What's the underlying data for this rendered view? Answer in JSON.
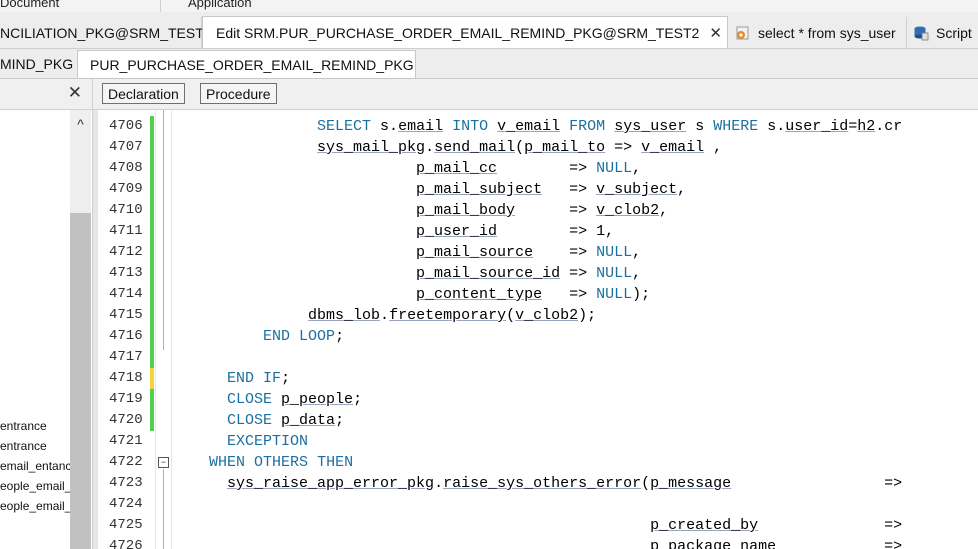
{
  "menu": {
    "items": [
      "Document",
      "Application"
    ]
  },
  "tabs": [
    {
      "label": "NCILIATION_PKG@SRM_TEST2",
      "icon": "none",
      "active": false
    },
    {
      "label": "Edit SRM.PUR_PURCHASE_ORDER_EMAIL_REMIND_PKG@SRM_TEST2",
      "icon": "database-package-icon",
      "active": true,
      "close": "✕"
    },
    {
      "label": "select * from sys_user",
      "icon": "sql-script-icon",
      "active": false
    },
    {
      "label": "Script",
      "icon": "database-script-icon",
      "active": false
    }
  ],
  "subtabs": [
    {
      "label": "MIND_PKG",
      "active": false
    },
    {
      "label": "PUR_PURCHASE_ORDER_EMAIL_REMIND_PKG",
      "active": true
    }
  ],
  "left_panel": {
    "close": "✕",
    "scroll_up": "^",
    "items": [
      "entrance",
      "entrance",
      "email_entanc",
      "eople_email_",
      "eople_email_"
    ]
  },
  "toolbar": {
    "declaration": "Declaration",
    "procedure": "Procedure"
  },
  "colors": {
    "keyword": "#1c6fa1",
    "change_green": "#4fd04f",
    "change_yellow": "#f5d33a"
  },
  "editor": {
    "lines": [
      {
        "num": "4706",
        "code": "                SELECT s.email INTO v_email FROM sys_user s WHERE s.user_id=h2.cr",
        "mark": "green"
      },
      {
        "num": "4707",
        "code": "                sys_mail_pkg.send_mail(p_mail_to => v_email ,",
        "mark": "green"
      },
      {
        "num": "4708",
        "code": "                           p_mail_cc        => NULL,",
        "mark": "green"
      },
      {
        "num": "4709",
        "code": "                           p_mail_subject   => v_subject,",
        "mark": "green"
      },
      {
        "num": "4710",
        "code": "                           p_mail_body      => v_clob2,",
        "mark": "green"
      },
      {
        "num": "4711",
        "code": "                           p_user_id        => 1,",
        "mark": "green"
      },
      {
        "num": "4712",
        "code": "                           p_mail_source    => NULL,",
        "mark": "green"
      },
      {
        "num": "4713",
        "code": "                           p_mail_source_id => NULL,",
        "mark": "green"
      },
      {
        "num": "4714",
        "code": "                           p_content_type   => NULL);",
        "mark": "green"
      },
      {
        "num": "4715",
        "code": "               dbms_lob.freetemporary(v_clob2);",
        "mark": "green"
      },
      {
        "num": "4716",
        "code": "          END LOOP;",
        "mark": "green"
      },
      {
        "num": "4717",
        "code": "",
        "mark": "green"
      },
      {
        "num": "4718",
        "code": "      END IF;",
        "mark": "yellow"
      },
      {
        "num": "4719",
        "code": "      CLOSE p_people;",
        "mark": "green"
      },
      {
        "num": "4720",
        "code": "      CLOSE p_data;",
        "mark": "green"
      },
      {
        "num": "4721",
        "code": "      EXCEPTION",
        "mark": "none"
      },
      {
        "num": "4722",
        "code": "    WHEN OTHERS THEN",
        "mark": "none"
      },
      {
        "num": "4723",
        "code": "      sys_raise_app_error_pkg.raise_sys_others_error(p_message                 =>",
        "mark": "none"
      },
      {
        "num": "4724",
        "code": "",
        "mark": "none"
      },
      {
        "num": "4725",
        "code": "                                                     p_created_by              =>",
        "mark": "none"
      },
      {
        "num": "4726",
        "code": "                                                     p_package_name            =>",
        "mark": "none"
      }
    ]
  }
}
